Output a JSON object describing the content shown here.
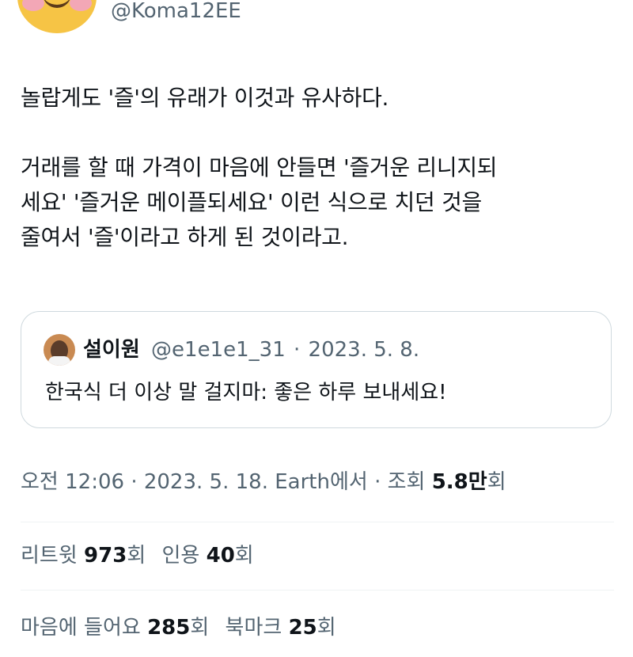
{
  "author": {
    "handle": "@Koma12EE"
  },
  "tweet": {
    "paragraph1": "놀랍게도 '즐'의 유래가 이것과 유사하다.",
    "paragraph2_line1": "거래를 할 때 가격이 마음에 안들면 '즐거운 리니지되",
    "paragraph2_line2": "세요' '즐거운 메이플되세요' 이런 식으로 치던 것을",
    "paragraph2_line3": "줄여서 '즐'이라고 하게 된 것이라고."
  },
  "quote": {
    "name": "설이원",
    "handle": "@e1e1e1_31",
    "separator": "·",
    "date": "2023. 5. 8.",
    "text": "한국식 더 이상 말 걸지마: 좋은 하루 보내세요!"
  },
  "meta": {
    "time": "오전 12:06",
    "sep1": "·",
    "date": "2023. 5. 18.",
    "location": "Earth에서",
    "sep2": "·",
    "views_label": "조회",
    "views_value": "5.8만",
    "views_unit": "회"
  },
  "stats": {
    "retweets_label": "리트윗",
    "retweets_value": "973",
    "retweets_unit": "회",
    "quotes_label": "인용",
    "quotes_value": "40",
    "quotes_unit": "회",
    "likes_label": "마음에 들어요",
    "likes_value": "285",
    "likes_unit": "회",
    "bookmarks_label": "북마크",
    "bookmarks_value": "25",
    "bookmarks_unit": "회"
  },
  "colors": {
    "text": "#0f1419",
    "secondary": "#536471",
    "border": "#cfd9de",
    "divider": "#eff3f4"
  },
  "icons": {
    "author_avatar": "smiling-face-avatar",
    "quote_avatar": "person-avatar"
  }
}
